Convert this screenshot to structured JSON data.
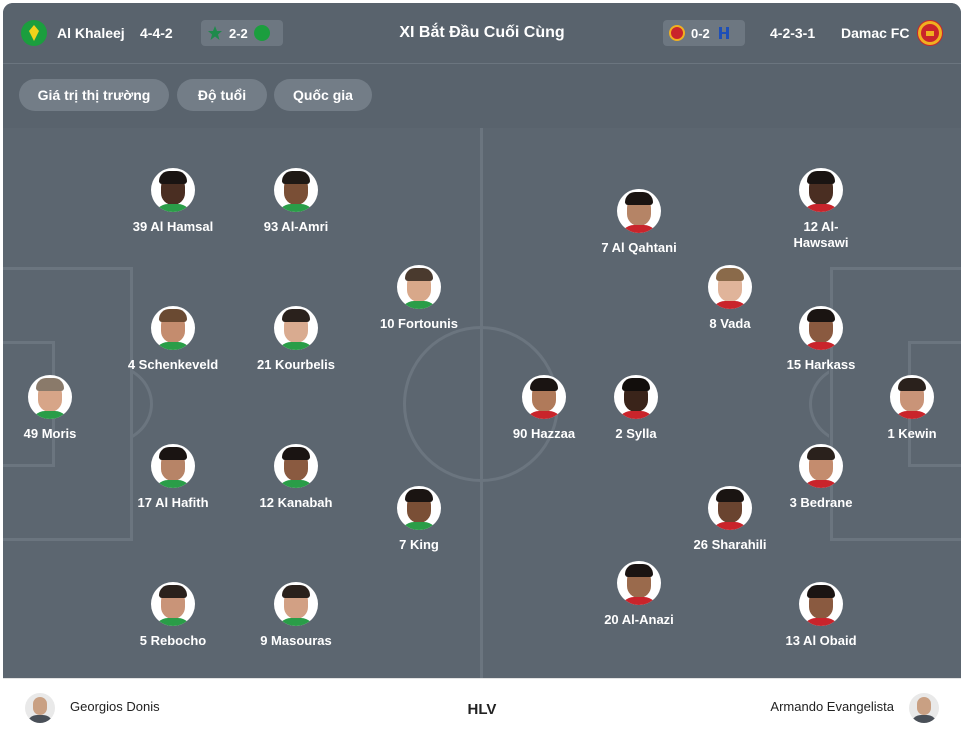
{
  "header": {
    "home_team": "Al Khaleej",
    "home_formation": "4-4-2",
    "home_last_score": "2-2",
    "title": "XI Bắt Đầu Cuối Cùng",
    "away_last_score": "0-2",
    "away_formation": "4-2-3-1",
    "away_team": "Damac FC"
  },
  "filters": [
    "Giá trị thị trường",
    "Độ tuổi",
    "Quốc gia"
  ],
  "home_players": [
    {
      "label": "39 Al Hamsal",
      "icon": "player-photo"
    },
    {
      "label": "93 Al-Amri",
      "icon": "player-photo"
    },
    {
      "label": "10 Fortounis",
      "icon": "player-photo"
    },
    {
      "label": "4 Schenkeveld",
      "icon": "player-photo"
    },
    {
      "label": "21 Kourbelis",
      "icon": "player-photo"
    },
    {
      "label": "49 Moris",
      "icon": "player-photo"
    },
    {
      "label": "17 Al Hafith",
      "icon": "player-photo"
    },
    {
      "label": "12 Kanabah",
      "icon": "player-photo"
    },
    {
      "label": "7 King",
      "icon": "player-photo"
    },
    {
      "label": "5 Rebocho",
      "icon": "player-photo"
    },
    {
      "label": "9 Masouras",
      "icon": "player-photo"
    }
  ],
  "away_players": [
    {
      "label": "7 Al Qahtani",
      "icon": "player-photo"
    },
    {
      "label": "12 Al-\nHawsawi",
      "icon": "player-photo"
    },
    {
      "label": "8 Vada",
      "icon": "player-photo"
    },
    {
      "label": "15 Harkass",
      "icon": "player-photo"
    },
    {
      "label": "90 Hazzaa",
      "icon": "player-photo"
    },
    {
      "label": "2 Sylla",
      "icon": "player-photo"
    },
    {
      "label": "1 Kewin",
      "icon": "player-photo"
    },
    {
      "label": "3 Bedrane",
      "icon": "player-photo"
    },
    {
      "label": "26 Sharahili",
      "icon": "player-photo"
    },
    {
      "label": "20 Al-Anazi",
      "icon": "player-photo"
    },
    {
      "label": "13 Al Obaid",
      "icon": "player-photo"
    }
  ],
  "footer": {
    "home_coach": "Georgios Donis",
    "label": "HLV",
    "away_coach": "Armando Evangelista"
  },
  "colors": {
    "pitch": "#5c6670",
    "header": "#59636d",
    "chip": "#737d87",
    "home_crest": "#1b9e3e",
    "away_crest": "#c9242b"
  }
}
